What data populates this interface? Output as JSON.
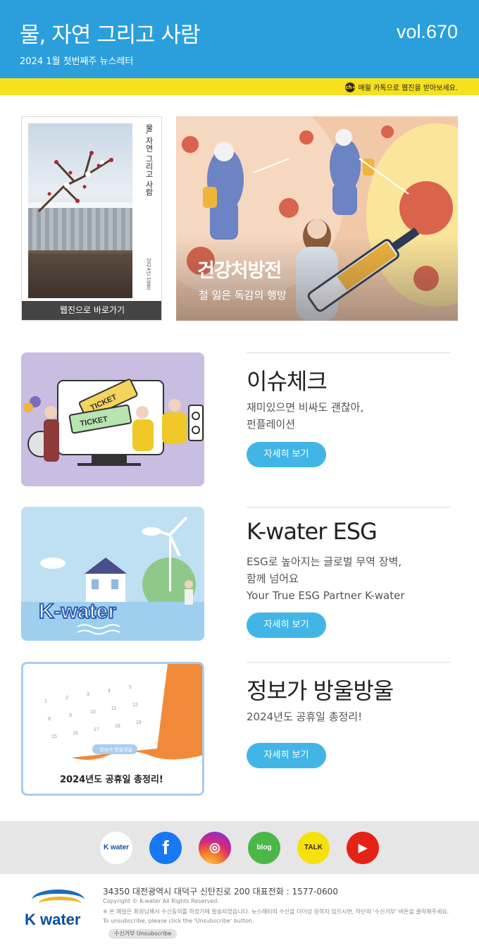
{
  "header": {
    "title": "물, 자연 그리고 사람",
    "subtitle": "2024 1월 첫번째주 뉴스레터",
    "volume": "vol.670",
    "kakao_badge": "ch+",
    "kakao_note": "매월 카톡으로 웹진을 받아보세요."
  },
  "cover": {
    "vertical_title": "물, 자연 그리고 사람",
    "vertical_date": "2024년 1월호",
    "button_label": "웹진으로 바로가기"
  },
  "hero": {
    "title": "건강처방전",
    "subtitle": "철 잃은 독감의 행방"
  },
  "articles": [
    {
      "title": "이슈체크",
      "description": "재미있으면 비싸도 괜찮아,\n펀플레이션",
      "button": "자세히 보기",
      "thumb_text": "TICKET"
    },
    {
      "title": "K-water ESG",
      "description": "ESG로 높아지는 글로벌 무역 장벽,\n함께 넘어요\nYour True ESG Partner K-water",
      "button": "자세히 보기",
      "thumb_text": "K-water"
    },
    {
      "title": "정보가 방울방울",
      "description": "2024년도 공휴일 총정리!",
      "button": "자세히 보기",
      "thumb_badge": "정보가 방울방울",
      "thumb_text": "2024년도 공휴일 총정리!"
    }
  ],
  "social": [
    {
      "name": "kwater",
      "label": "K water"
    },
    {
      "name": "facebook",
      "label": "f"
    },
    {
      "name": "instagram",
      "label": "◎"
    },
    {
      "name": "blog",
      "label": "blog"
    },
    {
      "name": "kakaotalk",
      "label": "TALK"
    },
    {
      "name": "youtube",
      "label": "▶"
    }
  ],
  "footer": {
    "logo": "K water",
    "address": "34350 대전광역시 대덕구 신탄진로 200  대표전화 : 1577-0600",
    "copyright": "Copyright © K-water All Rights Reserved.",
    "notice": "※ 본 메일은 회원님께서 수신동의를 하셨기에 발송되었습니다. 뉴스레터의 수신을 더이상 원하지 않으시면, 하단의 '수신거부' 버튼을 클릭해주세요.\n   To unsubscribe, please click the 'Unsubscribe' button.",
    "unsubscribe": "수신거부  Unsubscribe"
  }
}
